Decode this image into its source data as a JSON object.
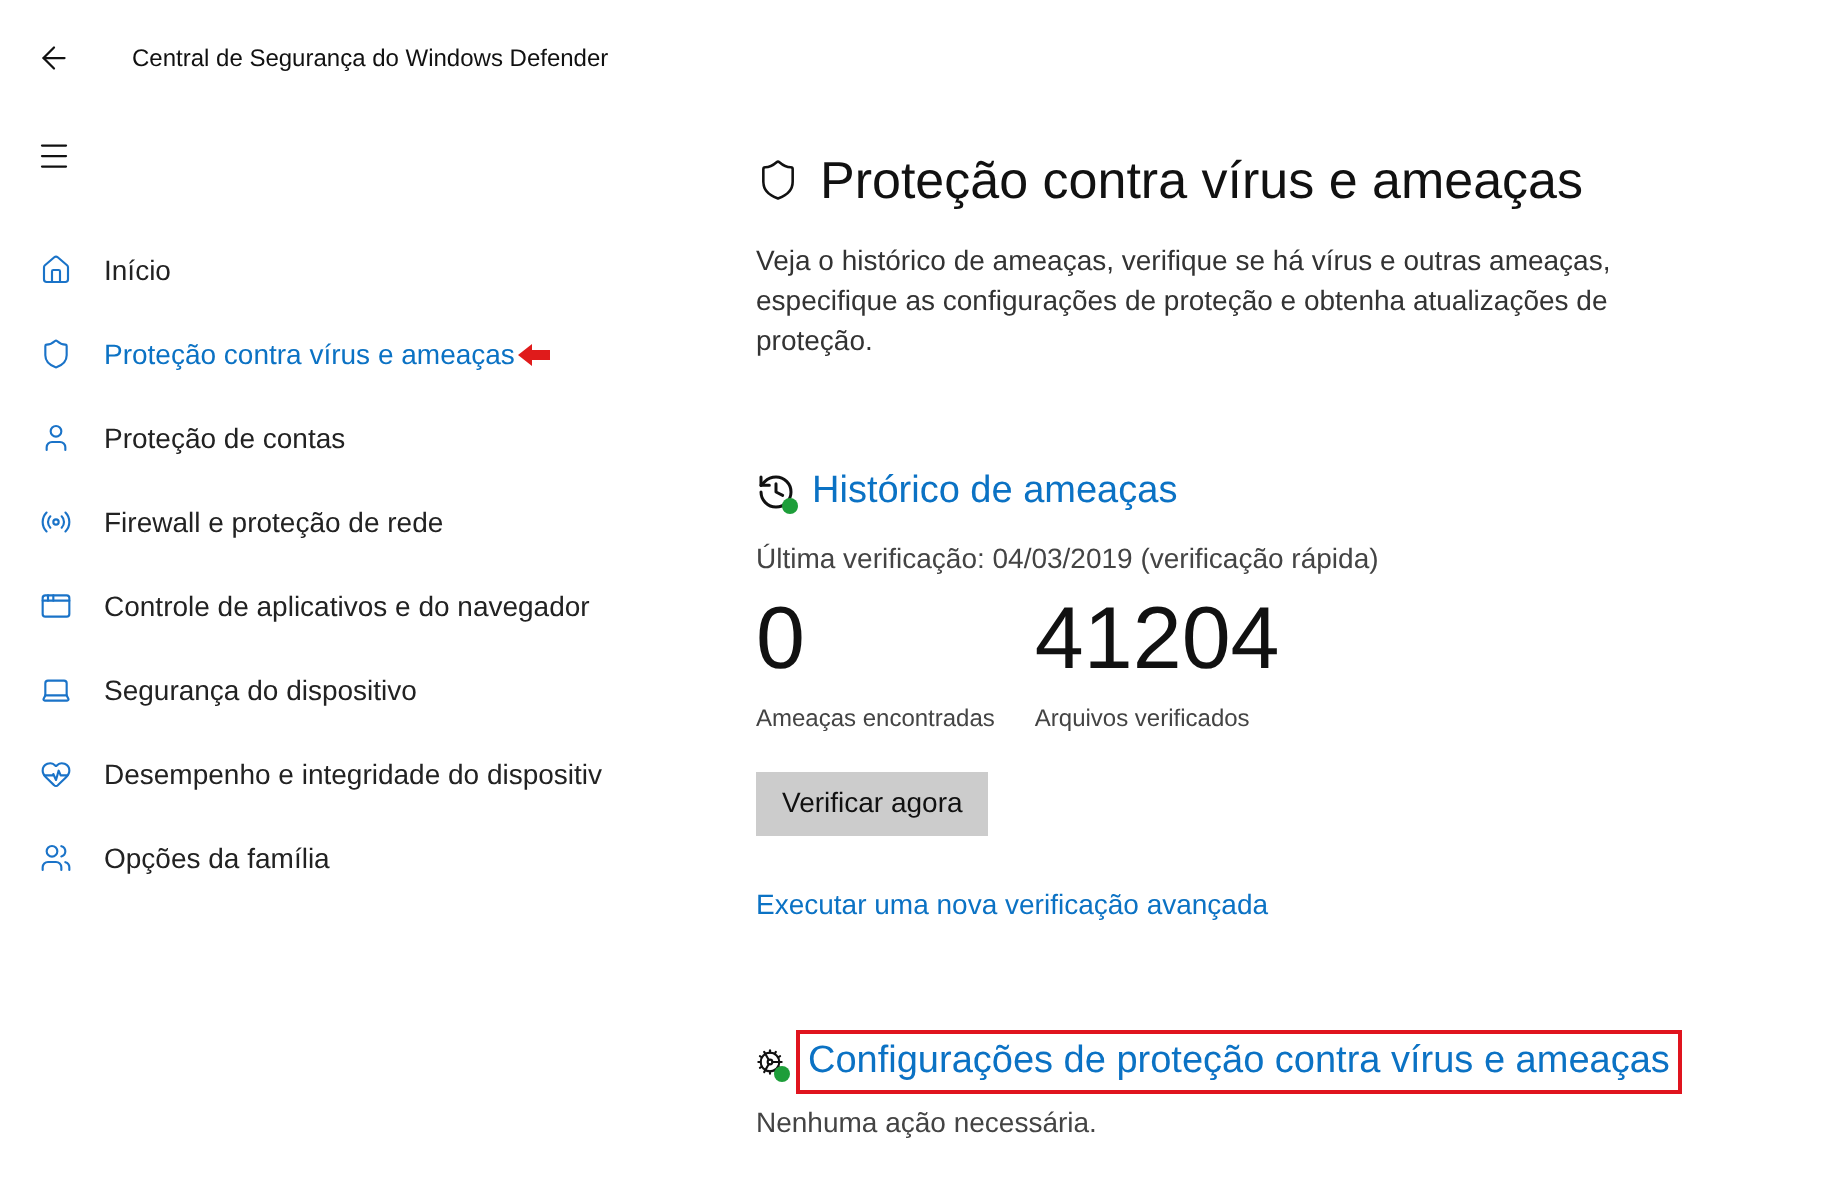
{
  "window": {
    "title": "Central de Segurança do Windows Defender"
  },
  "sidebar": {
    "items": [
      {
        "label": "Início",
        "selected": false,
        "marked": false
      },
      {
        "label": "Proteção contra vírus e ameaças",
        "selected": true,
        "marked": true
      },
      {
        "label": "Proteção de contas",
        "selected": false,
        "marked": false
      },
      {
        "label": "Firewall e proteção de rede",
        "selected": false,
        "marked": false
      },
      {
        "label": "Controle de aplicativos e do navegador",
        "selected": false,
        "marked": false
      },
      {
        "label": "Segurança do dispositivo",
        "selected": false,
        "marked": false
      },
      {
        "label": "Desempenho e integridade do dispositiv",
        "selected": false,
        "marked": false
      },
      {
        "label": "Opções da família",
        "selected": false,
        "marked": false
      }
    ]
  },
  "page": {
    "title": "Proteção contra vírus e ameaças",
    "description": "Veja o histórico de ameaças, verifique se há vírus e outras ameaças, especifique as configurações de proteção e obtenha atualizações de proteção."
  },
  "history": {
    "heading": "Histórico de ameaças",
    "last_scan": "Última verificação: 04/03/2019 (verificação rápida)",
    "stats": [
      {
        "value": "0",
        "label": "Ameaças encontradas"
      },
      {
        "value": "41204",
        "label": "Arquivos verificados"
      }
    ],
    "button": "Verificar agora",
    "link": "Executar uma nova verificação avançada"
  },
  "settings": {
    "heading": "Configurações de proteção contra vírus e ameaças",
    "highlighted": true,
    "status": "Nenhuma ação necessária."
  }
}
